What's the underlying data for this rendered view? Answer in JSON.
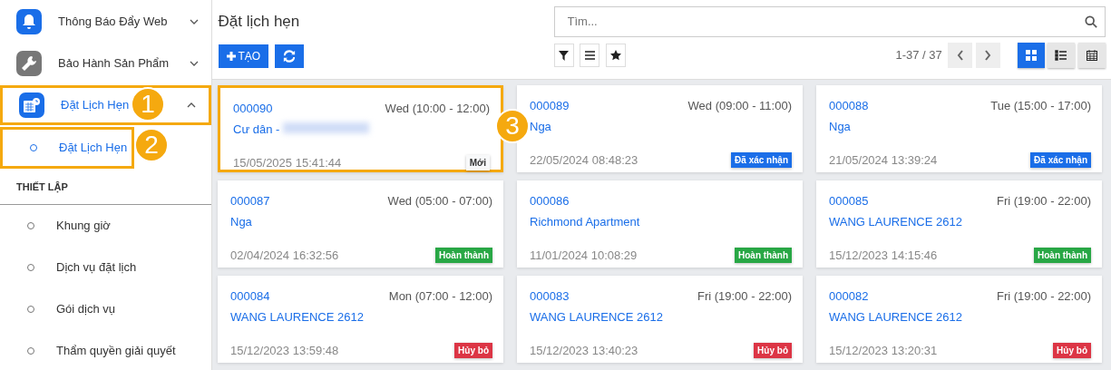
{
  "sidebar": {
    "menus": [
      {
        "label": "Thông Báo Đẩy Web",
        "expanded": false,
        "selected": false,
        "highlighted": false
      },
      {
        "label": "Bảo Hành Sản Phẩm",
        "expanded": false,
        "selected": false,
        "highlighted": false
      },
      {
        "label": "Đặt Lịch Hẹn",
        "expanded": true,
        "selected": true,
        "highlighted": true,
        "callout": "1",
        "children": [
          {
            "label": "Đặt Lịch Hẹn",
            "selected": true,
            "highlighted": true,
            "callout": "2"
          }
        ]
      }
    ],
    "section": "THIẾT LẬP",
    "items": [
      {
        "label": "Khung giờ",
        "selected": false
      },
      {
        "label": "Dịch vụ đặt lịch",
        "selected": false
      },
      {
        "label": "Gói dịch vụ",
        "selected": false
      },
      {
        "label": "Thẩm quyền giải quyết",
        "selected": false
      }
    ]
  },
  "title": "Đặt lịch hẹn",
  "create_button": "TẠO",
  "search": {
    "placeholder": "Tìm..."
  },
  "pager": "1-37 / 37",
  "views": [
    {
      "selected": true
    },
    {
      "selected": false
    },
    {
      "selected": false
    }
  ],
  "cards": [
    {
      "code": "000090",
      "slot": "Wed (10:00 - 12:00)",
      "name": "Cư dân -",
      "redacted": true,
      "created": "15/05/2025 15:41:44",
      "status": {
        "label": "Mới",
        "color": "#f8f9fa"
      },
      "highlighted": true,
      "callout": "3"
    },
    {
      "code": "000089",
      "slot": "Wed (09:00 - 11:00)",
      "name": "Nga",
      "redacted": false,
      "created": "22/05/2024 08:48:23",
      "status": {
        "label": "Đã xác nhận",
        "color": "#1a6ee8"
      },
      "highlighted": false
    },
    {
      "code": "000088",
      "slot": "Tue (15:00 - 17:00)",
      "name": "Nga",
      "redacted": false,
      "created": "21/05/2024 13:39:24",
      "status": {
        "label": "Đã xác nhận",
        "color": "#1a6ee8"
      },
      "highlighted": false
    },
    {
      "code": "000087",
      "slot": "Wed (05:00 - 07:00)",
      "name": "Nga",
      "redacted": false,
      "created": "02/04/2024 16:32:56",
      "status": {
        "label": "Hoàn thành",
        "color": "#28a745"
      },
      "highlighted": false
    },
    {
      "code": "000086",
      "name": "Richmond Apartment",
      "redacted": false,
      "created": "11/01/2024 10:08:29",
      "status": {
        "label": "Hoàn thành",
        "color": "#28a745"
      },
      "highlighted": false
    },
    {
      "code": "000085",
      "slot": "Fri (19:00 - 22:00)",
      "name": "WANG LAURENCE 2612",
      "redacted": false,
      "created": "15/12/2023 14:15:46",
      "status": {
        "label": "Hoàn thành",
        "color": "#28a745"
      },
      "highlighted": false
    },
    {
      "code": "000084",
      "slot": "Mon (07:00 - 12:00)",
      "name": "WANG LAURENCE 2612",
      "redacted": false,
      "created": "15/12/2023 13:59:48",
      "status": {
        "label": "Hủy bỏ",
        "color": "#dc3545"
      },
      "highlighted": false
    },
    {
      "code": "000083",
      "slot": "Fri (19:00 - 22:00)",
      "name": "WANG LAURENCE 2612",
      "redacted": false,
      "created": "15/12/2023 13:40:23",
      "status": {
        "label": "Hủy bỏ",
        "color": "#dc3545"
      },
      "highlighted": false
    },
    {
      "code": "000082",
      "slot": "Fri (19:00 - 22:00)",
      "name": "WANG LAURENCE 2612",
      "redacted": false,
      "created": "15/12/2023 13:20:31",
      "status": {
        "label": "Hủy bỏ",
        "color": "#dc3545"
      },
      "highlighted": false
    }
  ]
}
